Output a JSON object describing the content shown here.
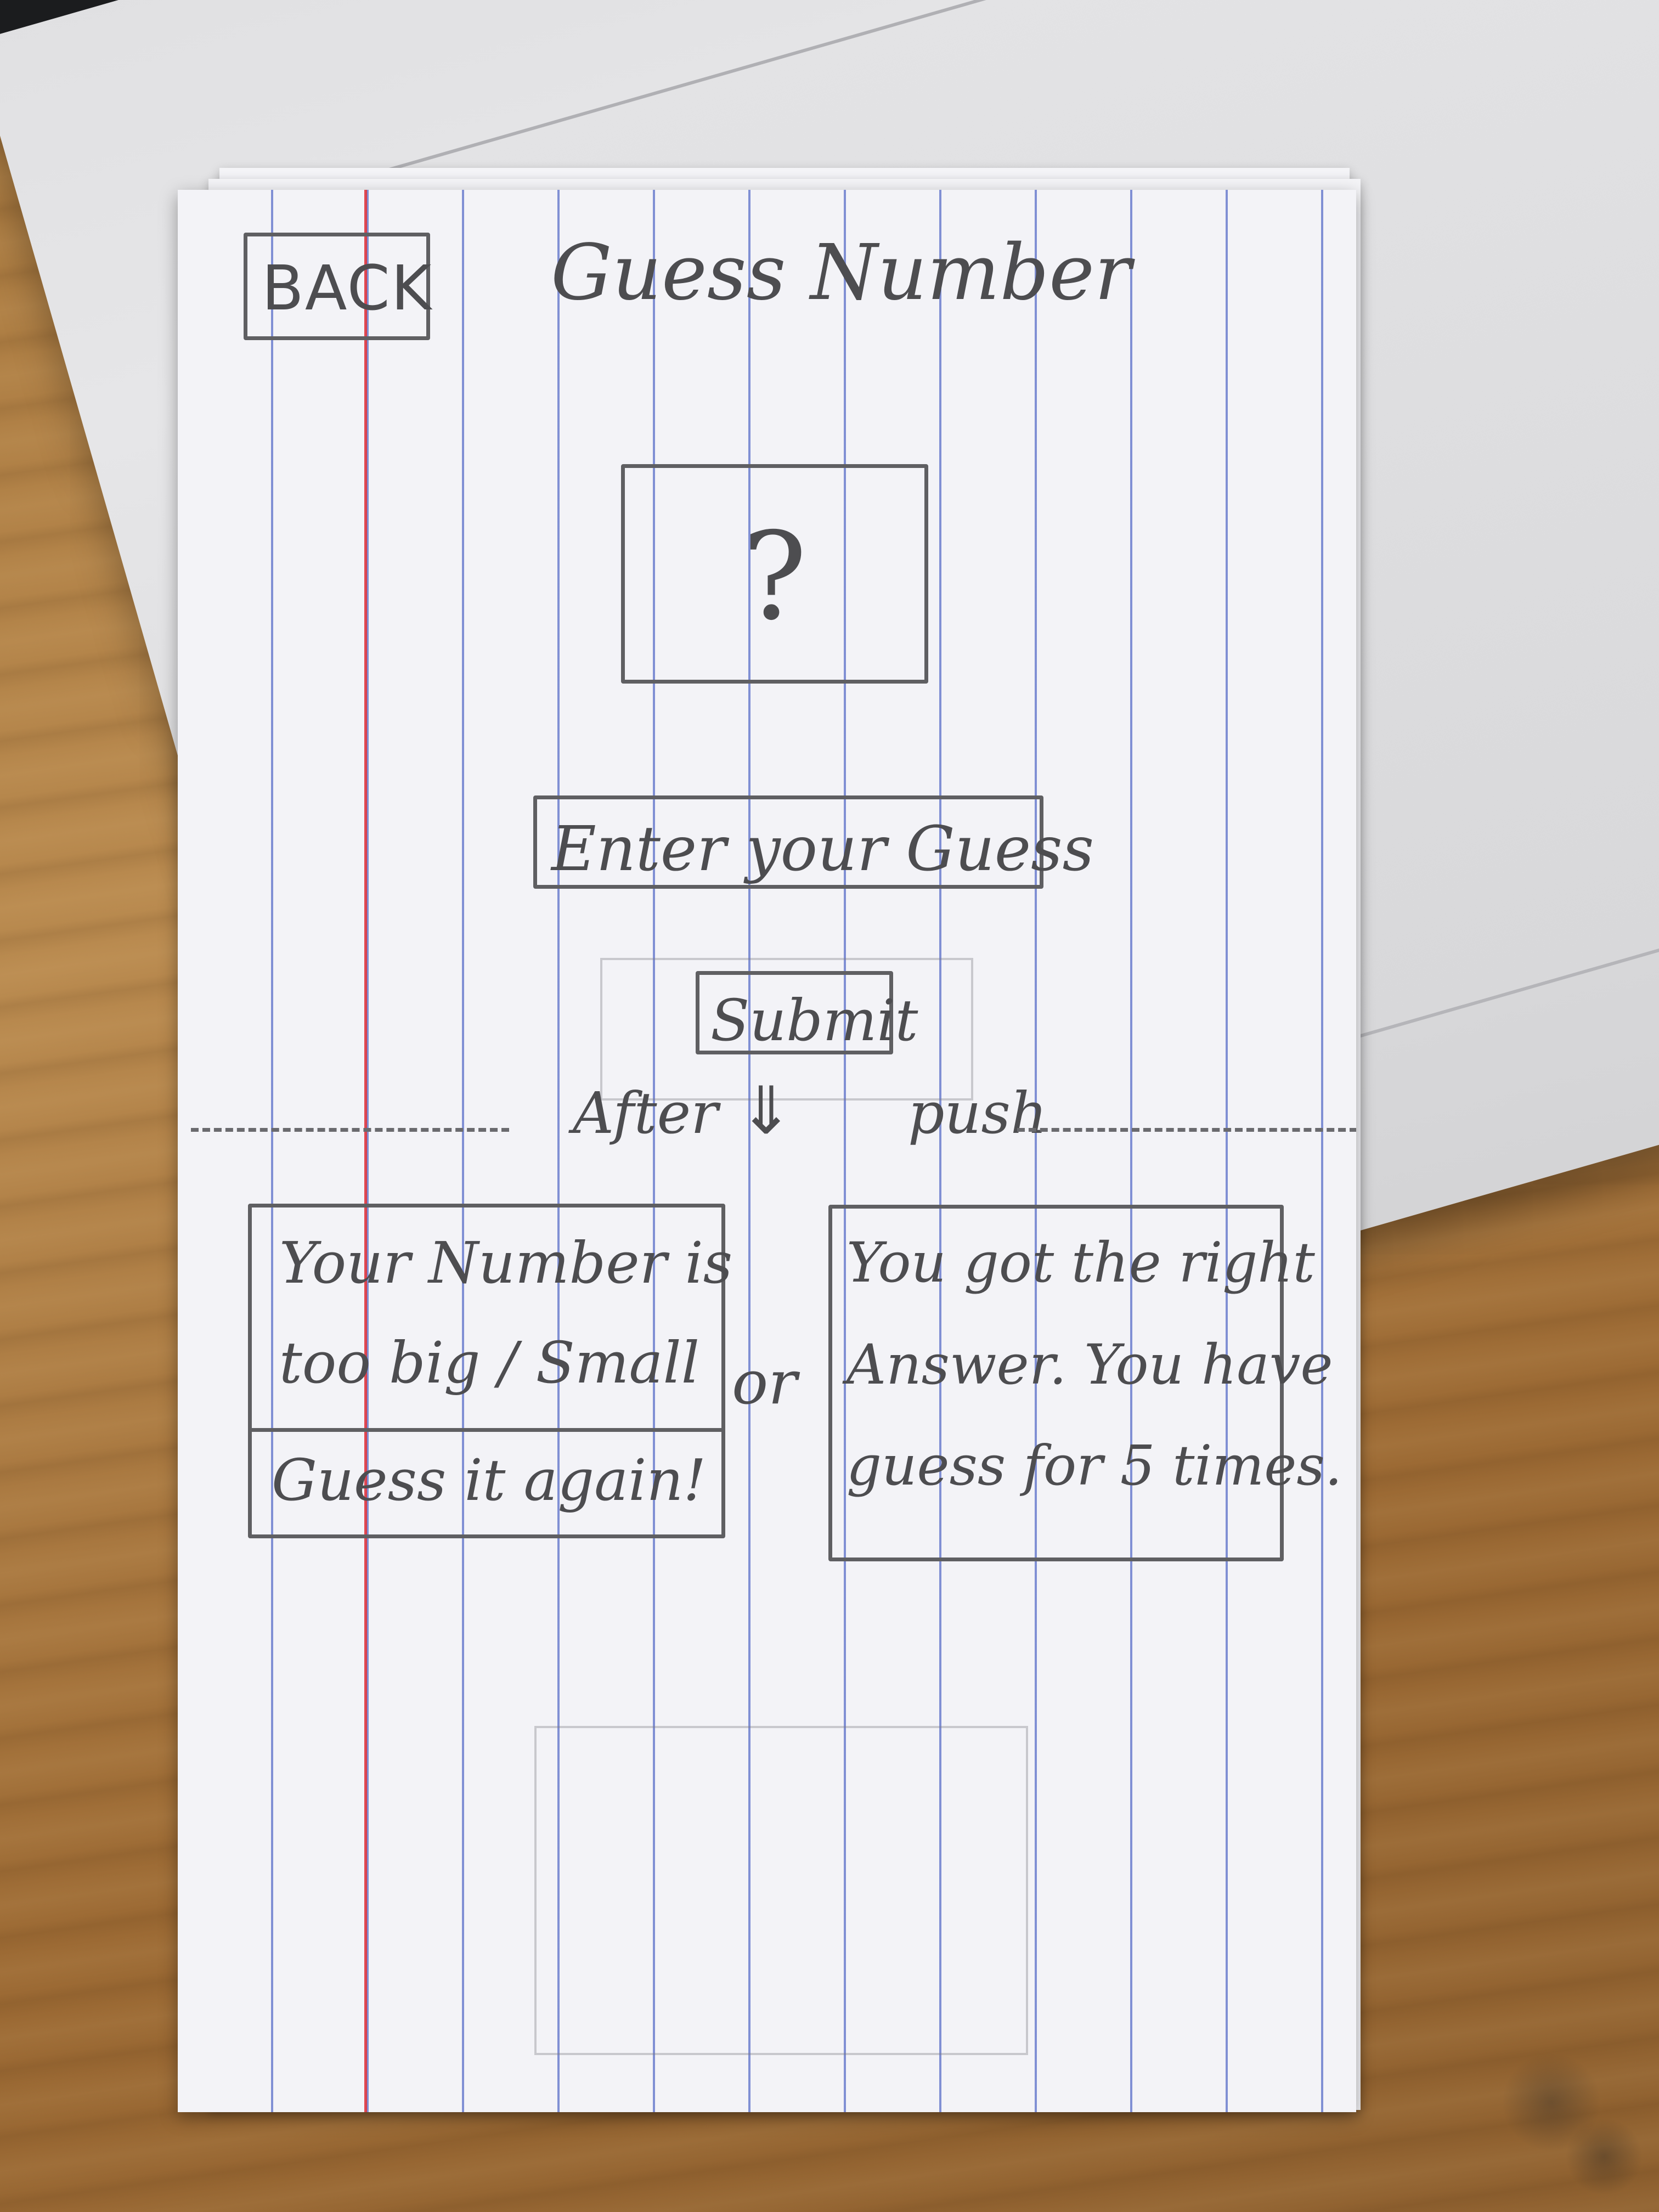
{
  "header": {
    "back_label": "BACK",
    "title": "Guess Number"
  },
  "image_placeholder": {
    "symbol": "?"
  },
  "guess_input": {
    "placeholder": "Enter your Guess"
  },
  "submit_label": "Submit",
  "transition": {
    "before": "After",
    "arrow": "⇓",
    "after": "push"
  },
  "results": {
    "wrong": {
      "line1": "Your Number is",
      "line2": "too big / Small",
      "line3": "Guess it again!"
    },
    "separator": "or",
    "right": {
      "line1": "You got the right",
      "line2": "Answer. You have",
      "line3": "guess for 5 times."
    }
  },
  "colors": {
    "ruling_blue": "#5a6ec8",
    "margin_red": "#dc2832",
    "pencil": "#5f5f62",
    "card": "#f3f3f7",
    "desk_wood": "#a9793f",
    "laptop": "#dcdcde"
  }
}
